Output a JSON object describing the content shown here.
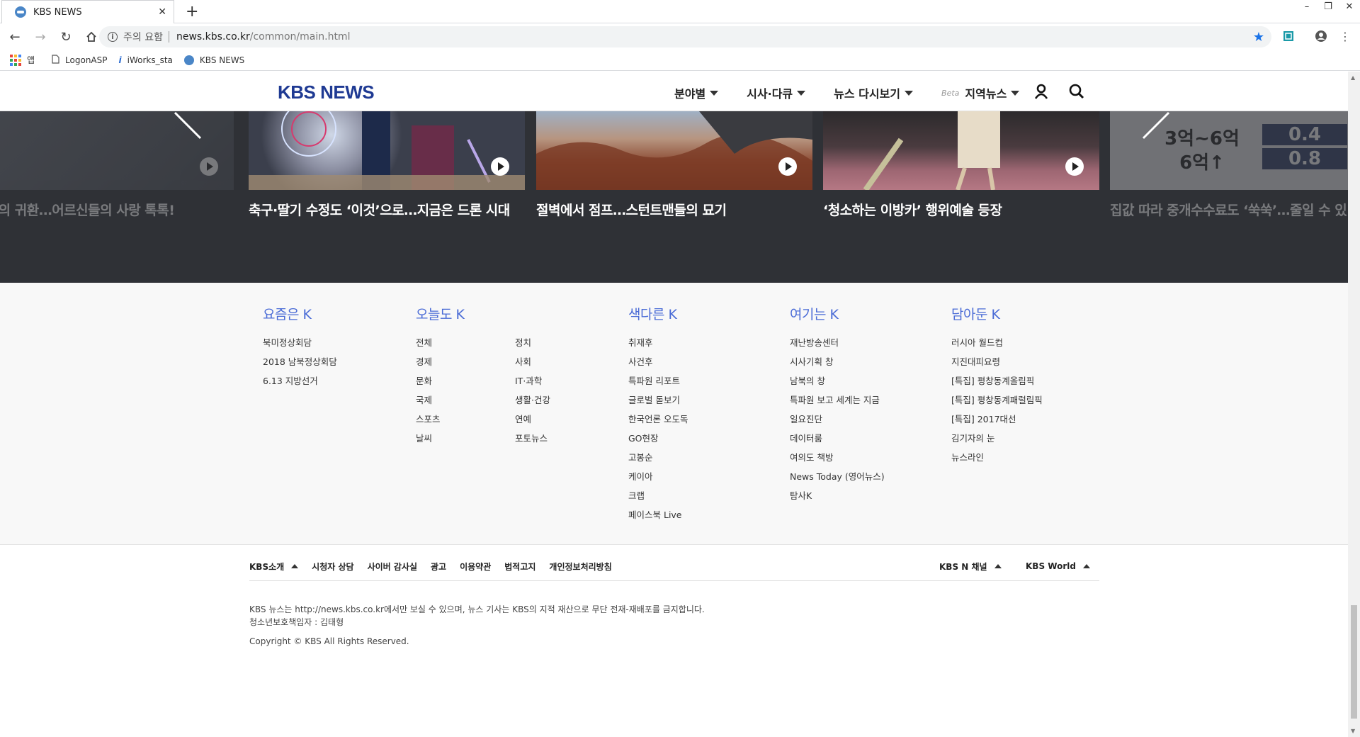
{
  "browser": {
    "tab_title": "KBS NEWS",
    "tab_close": "✕",
    "new_tab": "+",
    "security_label": "주의 요함",
    "url_host": "news.kbs.co.kr",
    "url_path": "/common/main.html",
    "bookmarks": [
      {
        "label": "앱"
      },
      {
        "label": "LogonASP"
      },
      {
        "label": "iWorks_sta"
      },
      {
        "label": "KBS NEWS"
      }
    ]
  },
  "header": {
    "logo": "KBS NEWS",
    "menu": [
      {
        "label": "분야별"
      },
      {
        "label": "시사·다큐"
      },
      {
        "label": "뉴스 다시보기"
      },
      {
        "label": "지역뉴스",
        "badge": "Beta"
      }
    ]
  },
  "carousel": {
    "items": [
      {
        "title": "안내원’의 귀환…어르신들의 사랑 톡톡!"
      },
      {
        "title": "축구·딸기 수정도 ‘이것’으로…지금은 드론 시대"
      },
      {
        "title": "절벽에서 점프…스턴트맨들의 묘기"
      },
      {
        "title": "‘청소하는 이방카’ 행위예술 등장"
      },
      {
        "title": "집값 따라 중개수수료도 ‘쑥쑥’…줄일 수 있"
      }
    ],
    "chart_rows": [
      {
        "label": "3억~6억",
        "value": "0.4"
      },
      {
        "label": "6억↑",
        "value": "0.8"
      }
    ]
  },
  "sitemap": {
    "col1": {
      "title": "요즘은 K",
      "items": [
        "북미정상회담",
        "2018 남북정상회담",
        "6.13 지방선거"
      ]
    },
    "col2": {
      "title": "오늘도 K",
      "items_a": [
        "전체",
        "경제",
        "문화",
        "국제",
        "스포츠",
        "날씨"
      ],
      "items_b": [
        "정치",
        "사회",
        "IT·과학",
        "생활·건강",
        "연예",
        "포토뉴스"
      ]
    },
    "col3": {
      "title": "색다른 K",
      "items": [
        "취재후",
        "사건후",
        "특파원 리포트",
        "글로벌 돋보기",
        "한국언론 오도독",
        "GO현장",
        "고봉순",
        "케이아",
        "크랩",
        "페이스북 Live"
      ]
    },
    "col4": {
      "title": "여기는 K",
      "items": [
        "재난방송센터",
        "시사기획 창",
        "남북의 창",
        "특파원 보고 세계는 지금",
        "일요진단",
        "데이터룸",
        "여의도 책방",
        "News Today (영어뉴스)",
        "탐사K"
      ]
    },
    "col5": {
      "title": "담아둔 K",
      "items": [
        "러시아 월드컵",
        "지진대피요령",
        "[특집] 평창동계올림픽",
        "[특집] 평창동계패럴림픽",
        "[특집] 2017대선",
        "김기자의 눈",
        "뉴스라인"
      ]
    }
  },
  "footer": {
    "links": [
      "KBS소개",
      "시청자 상담",
      "사이버 감사실",
      "광고",
      "이용약관",
      "법적고지",
      "개인정보처리방침"
    ],
    "channel": "KBS N 채널",
    "world": "KBS World",
    "notice": "KBS 뉴스는 http://news.kbs.co.kr에서만 보실 수 있으며, 뉴스 기사는 KBS의 지적 재산으로 무단 전재-재배포를 금지합니다.",
    "youth": "청소년보호책임자 : 김태형",
    "copyright": "Copyright © KBS All Rights Reserved."
  },
  "colors": {
    "brand": "#1f3a93",
    "sitemap_title": "#4a6bd6",
    "carousel_bg": "#2f3136"
  }
}
